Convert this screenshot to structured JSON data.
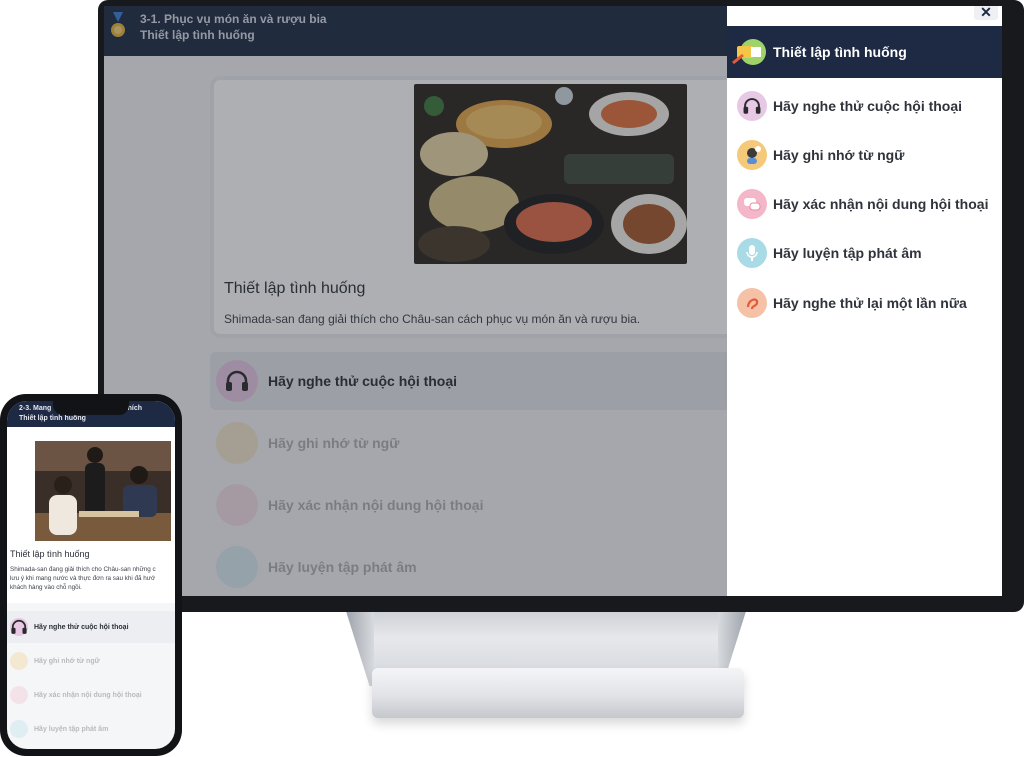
{
  "desktop": {
    "header": {
      "lesson_title": "3-1. Phục vụ món ăn và rượu bia",
      "section_title": "Thiết lập tình huống"
    },
    "scenario_card": {
      "title": "Thiết lập tình huống",
      "description": "Shimada-san đang giải thích cho Châu-san cách phục vụ món ăn và rượu bia."
    },
    "steps": [
      {
        "label": "Hãy nghe thử cuộc hội thoại"
      },
      {
        "label": "Hãy ghi nhớ từ ngữ"
      },
      {
        "label": "Hãy xác nhận nội dung hội thoại"
      },
      {
        "label": "Hãy luyện tập phát âm"
      }
    ],
    "drawer": {
      "close_glyph": "✕",
      "header_label": "Thiết lập tình huống",
      "items": [
        {
          "label": "Hãy nghe thử cuộc hội thoại",
          "icon": "headphones-icon",
          "color": "#e7c9e6"
        },
        {
          "label": "Hãy ghi nhớ từ ngữ",
          "icon": "person-thinking-icon",
          "color": "#f5c97a"
        },
        {
          "label": "Hãy xác nhận nội dung hội thoại",
          "icon": "speech-bubbles-icon",
          "color": "#f4b7c9"
        },
        {
          "label": "Hãy luyện tập phát âm",
          "icon": "microphone-icon",
          "color": "#a9dbe6"
        },
        {
          "label": "Hãy nghe thử lại một lần nữa",
          "icon": "ear-icon",
          "color": "#f5c2a8"
        }
      ]
    }
  },
  "phone": {
    "header": {
      "lesson_title": "2-3. Mang",
      "lesson_title_tail": "thích",
      "section_title": "Thiết lập tình huống"
    },
    "scenario_card": {
      "title": "Thiết lập tình huống",
      "description_lines": [
        "Shimada-san đang giải thích cho Châu-san những c",
        "lưu ý khi mang nước và thực đơn ra sau khi đã hướ",
        "khách hàng vào chỗ ngồi."
      ]
    },
    "steps": [
      {
        "label": "Hãy nghe thử cuộc hội thoại"
      },
      {
        "label": "Hãy ghi nhớ từ ngữ"
      },
      {
        "label": "Hãy xác nhận nội dung hội thoại"
      },
      {
        "label": "Hãy luyện tập phát âm"
      }
    ]
  },
  "colors": {
    "header_navy": "#1e2a44",
    "step_headphones": "#e7c9e6",
    "step_memo": "#f5c97a",
    "step_chat": "#f4b7c9",
    "step_mic": "#a9dbe6"
  }
}
